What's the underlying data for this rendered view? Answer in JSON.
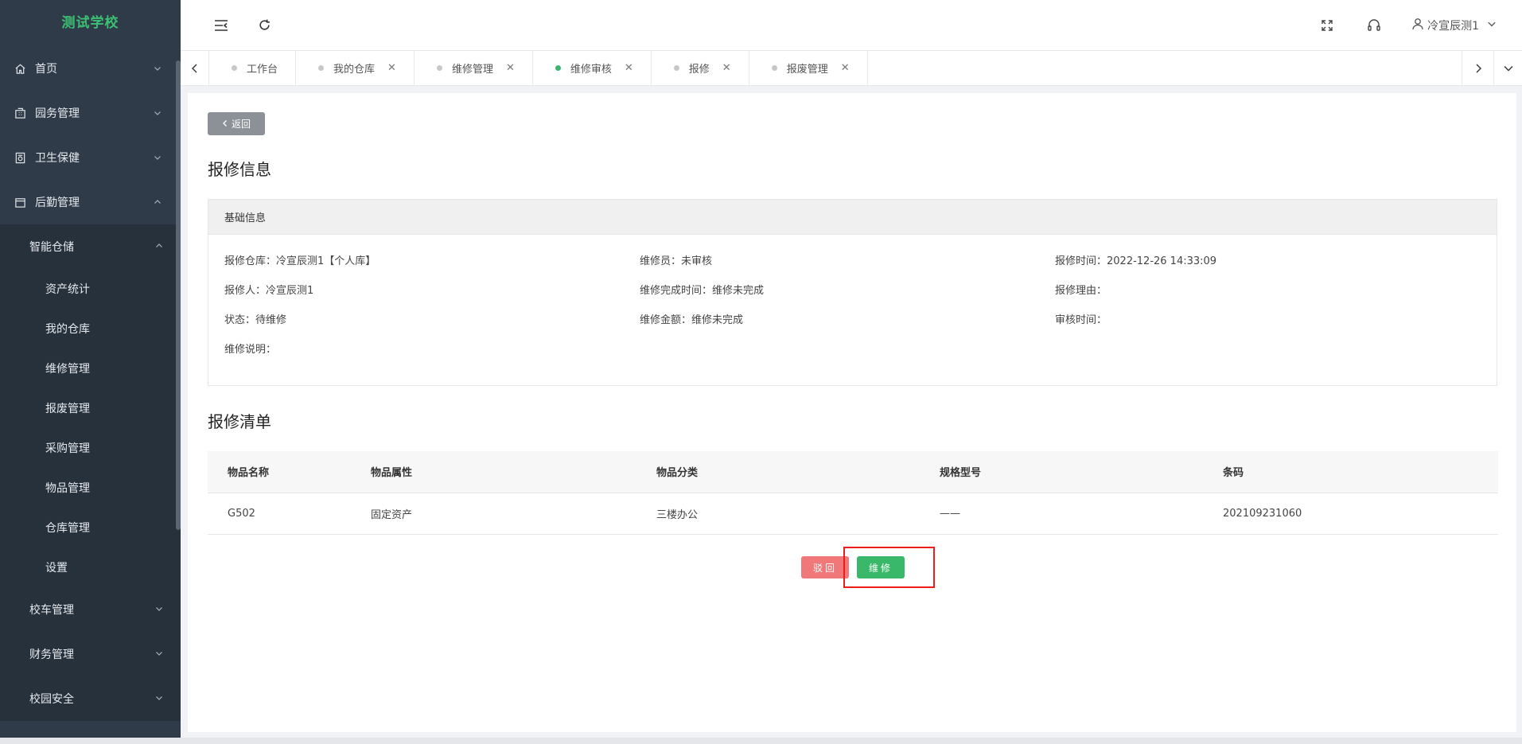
{
  "sidebar": {
    "logo": "测试学校",
    "menu": [
      {
        "label": "首页",
        "icon": "home-icon"
      },
      {
        "label": "园务管理",
        "icon": "building-icon"
      },
      {
        "label": "卫生保健",
        "icon": "health-icon"
      },
      {
        "label": "后勤管理",
        "icon": "logistics-icon"
      }
    ],
    "submenu_open": "智能仓储",
    "leaf_items": [
      "资产统计",
      "我的仓库",
      "维修管理",
      "报废管理",
      "采购管理",
      "物品管理",
      "仓库管理",
      "设置"
    ],
    "other_sub": [
      "校车管理",
      "财务管理",
      "校园安全"
    ]
  },
  "header": {
    "user_name": "冷宣辰测1"
  },
  "tabs": [
    {
      "label": "工作台",
      "closable": false,
      "active": false
    },
    {
      "label": "我的仓库",
      "closable": true,
      "active": false
    },
    {
      "label": "维修管理",
      "closable": true,
      "active": false
    },
    {
      "label": "维修审核",
      "closable": true,
      "active": true
    },
    {
      "label": "报修",
      "closable": true,
      "active": false
    },
    {
      "label": "报废管理",
      "closable": true,
      "active": false
    }
  ],
  "content": {
    "back_label": "返回",
    "repair_info_title": "报修信息",
    "basic_info_title": "基础信息",
    "fields": {
      "warehouse": "报修仓库：冷宣辰测1【个人库】",
      "repairer": "维修员：未审核",
      "report_time": "报修时间：2022-12-26 14:33:09",
      "reporter": "报修人：冷宣辰测1",
      "finish_time": "维修完成时间：维修未完成",
      "reason": "报修理由：",
      "status": "状态：待维修",
      "amount": "维修金额：维修未完成",
      "audit_time": "审核时间：",
      "description": "维修说明："
    },
    "list_title": "报修清单",
    "table": {
      "headers": [
        "物品名称",
        "物品属性",
        "物品分类",
        "规格型号",
        "条码"
      ],
      "rows": [
        [
          "G502",
          "固定资产",
          "三楼办公",
          "——",
          "202109231060"
        ]
      ]
    },
    "reject_label": "驳回",
    "repair_label": "维修"
  }
}
